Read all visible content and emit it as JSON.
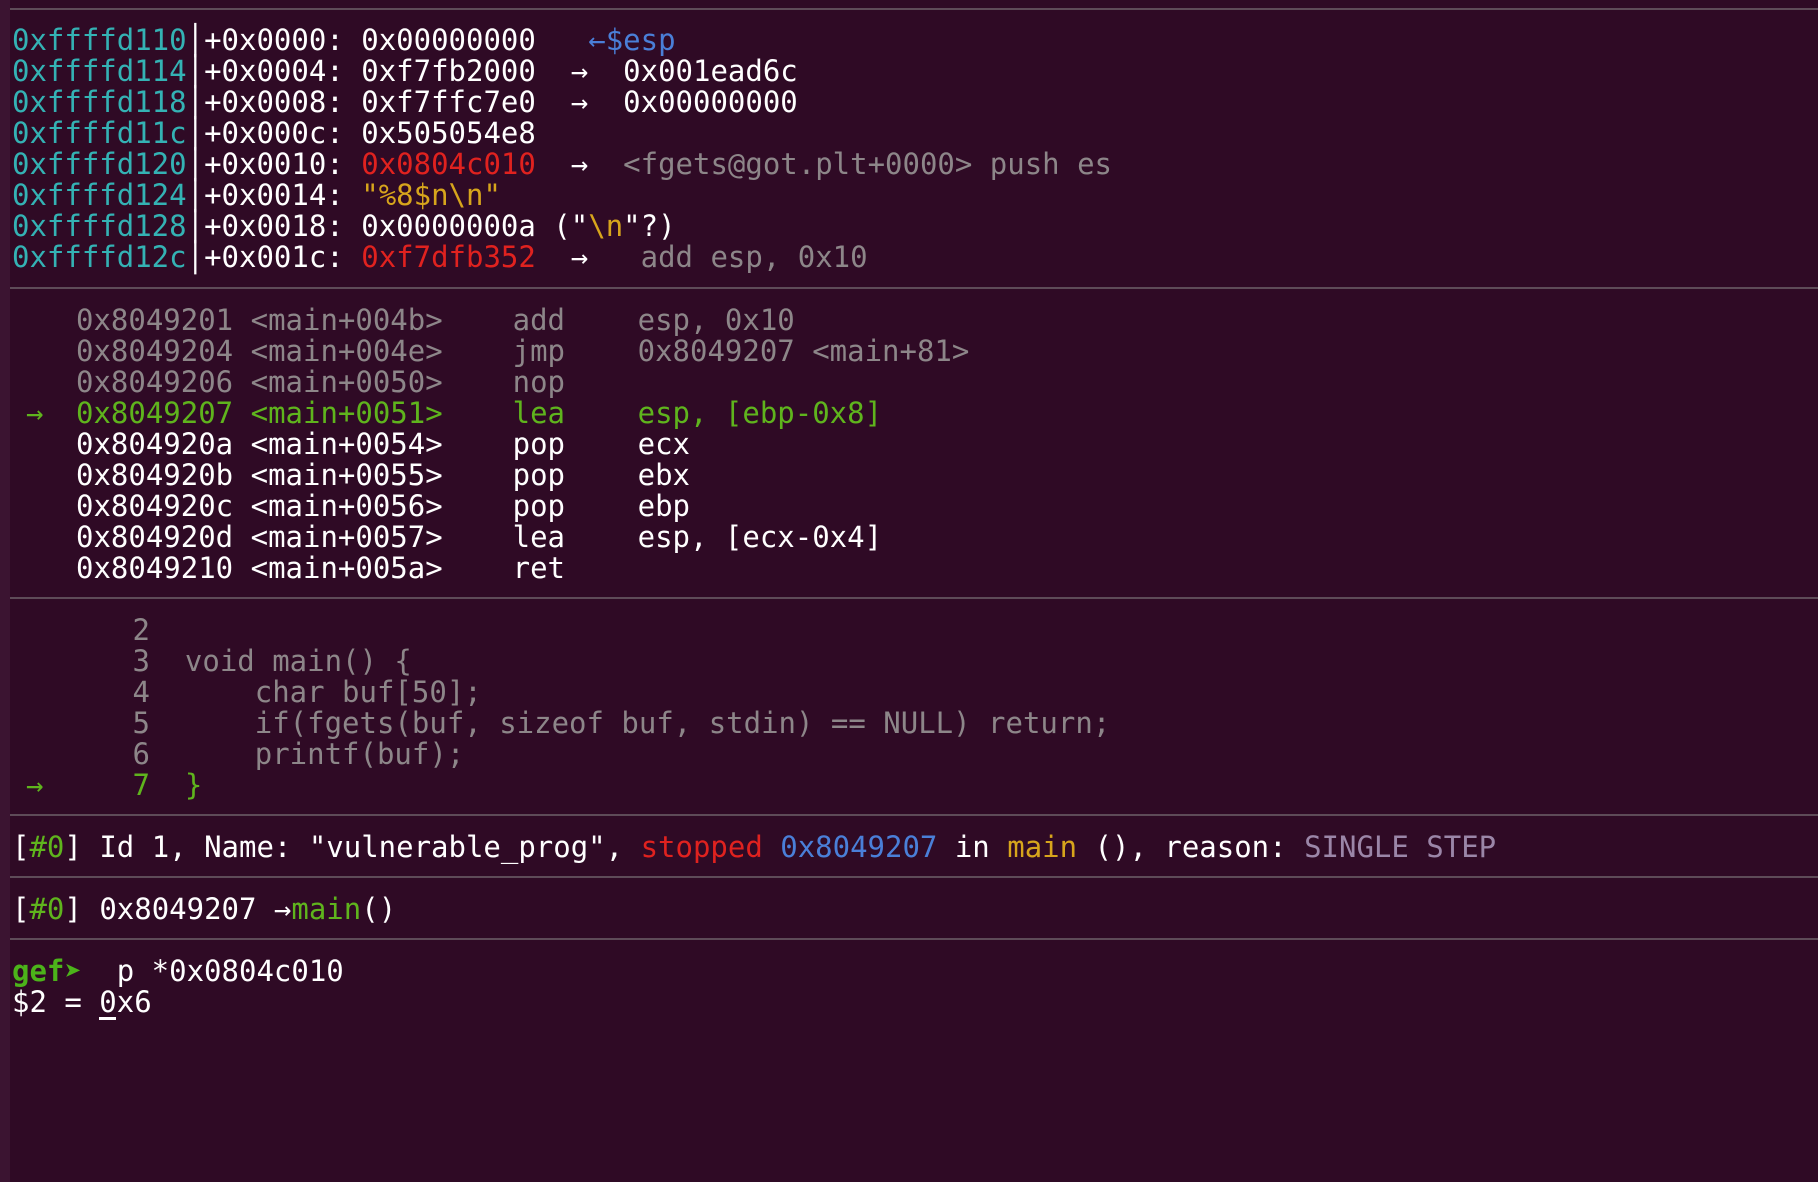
{
  "stack": {
    "rows": [
      {
        "addr": "0xffffd110",
        "offset": "+0x0000:",
        "value": "0x00000000",
        "arrow": "←",
        "target": "$esp"
      },
      {
        "addr": "0xffffd114",
        "offset": "+0x0004:",
        "value": "0xf7fb2000",
        "arrow": "→",
        "target": "0x001ead6c"
      },
      {
        "addr": "0xffffd118",
        "offset": "+0x0008:",
        "value": "0xf7ffc7e0",
        "arrow": "→",
        "target": "0x00000000"
      },
      {
        "addr": "0xffffd11c",
        "offset": "+0x000c:",
        "value": "0x505054e8",
        "arrow": "",
        "target": ""
      },
      {
        "addr": "0xffffd120",
        "offset": "+0x0010:",
        "value": "0x0804c010",
        "arrow": "→",
        "target": "<fgets@got.plt+0000> push es"
      },
      {
        "addr": "0xffffd124",
        "offset": "+0x0014:",
        "value": "\"%8$n\\n\"",
        "arrow": "",
        "target": ""
      },
      {
        "addr": "0xffffd128",
        "offset": "+0x0018:",
        "value": "0x0000000a",
        "extra_pre": " (\"",
        "extra_nl": "\\n",
        "extra_post": "\"?)"
      },
      {
        "addr": "0xffffd12c",
        "offset": "+0x001c:",
        "value": "0xf7dfb352",
        "arrow": "→",
        "target": "add esp, 0x10"
      }
    ]
  },
  "disasm": {
    "rows": [
      {
        "marker": "",
        "addr": "0x8049201",
        "sym": "<main+004b>",
        "mnem": "add",
        "ops": "esp, 0x10"
      },
      {
        "marker": "",
        "addr": "0x8049204",
        "sym": "<main+004e>",
        "mnem": "jmp",
        "ops": "0x8049207 <main+81>"
      },
      {
        "marker": "",
        "addr": "0x8049206",
        "sym": "<main+0050>",
        "mnem": "nop",
        "ops": ""
      },
      {
        "marker": "→",
        "addr": "0x8049207",
        "sym": "<main+0051>",
        "mnem": "lea",
        "ops": "esp, [ebp-0x8]"
      },
      {
        "marker": "",
        "addr": "0x804920a",
        "sym": "<main+0054>",
        "mnem": "pop",
        "ops": "ecx"
      },
      {
        "marker": "",
        "addr": "0x804920b",
        "sym": "<main+0055>",
        "mnem": "pop",
        "ops": "ebx"
      },
      {
        "marker": "",
        "addr": "0x804920c",
        "sym": "<main+0056>",
        "mnem": "pop",
        "ops": "ebp"
      },
      {
        "marker": "",
        "addr": "0x804920d",
        "sym": "<main+0057>",
        "mnem": "lea",
        "ops": "esp, [ecx-0x4]"
      },
      {
        "marker": "",
        "addr": "0x8049210",
        "sym": "<main+005a>",
        "mnem": "ret",
        "ops": ""
      }
    ]
  },
  "source": {
    "rows": [
      {
        "marker": "",
        "num": "2",
        "code": ""
      },
      {
        "marker": "",
        "num": "3",
        "code": "void main() {"
      },
      {
        "marker": "",
        "num": "4",
        "code": "    char buf[50];"
      },
      {
        "marker": "",
        "num": "5",
        "code": "    if(fgets(buf, sizeof buf, stdin) == NULL) return;"
      },
      {
        "marker": "",
        "num": "6",
        "code": "    printf(buf);"
      },
      {
        "marker": "→",
        "num": "7",
        "code": "}"
      }
    ]
  },
  "threads": {
    "open": "[",
    "id": "#0",
    "close": "]",
    "text1": " Id 1, Name: \"vulnerable_prog\", ",
    "stopped": "stopped",
    "addr": " 0x8049207",
    "in": " in ",
    "func": "main",
    "text2": " (), reason: ",
    "reason": "SINGLE STEP"
  },
  "trace": {
    "open": "[",
    "id": "#0",
    "close": "]",
    "addr": " 0x8049207 ",
    "arrow": "→",
    "func": "main",
    "parens": "()"
  },
  "prompt": {
    "label": "gef➤",
    "command": "  p *0x0804c010",
    "output": "$2 = 0x6"
  }
}
